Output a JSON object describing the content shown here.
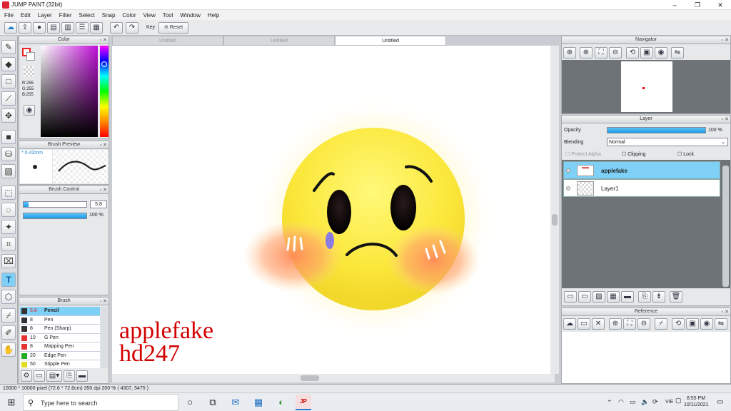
{
  "window": {
    "title": "JUMP PAINT (32bit)",
    "controls": [
      "–",
      "❐",
      "✕"
    ]
  },
  "menu": [
    "File",
    "Edit",
    "Layer",
    "Filter",
    "Select",
    "Snap",
    "Color",
    "View",
    "Tool",
    "Window",
    "Help"
  ],
  "toolbar": {
    "key_label": "Key",
    "reset_label": "Reset"
  },
  "color_panel": {
    "title": "Color",
    "r": "R:255",
    "g": "G:255",
    "b": "B:255"
  },
  "brush_preview": {
    "title": "Brush Preview",
    "size": "0.42mm"
  },
  "brush_control": {
    "title": "Brush Control",
    "size_value": "5.8",
    "opacity_value": "100 %",
    "opacity_level": 1.0
  },
  "brush_panel": {
    "title": "Brush",
    "items": [
      {
        "size": "5.8",
        "name": "Pencil",
        "color": "#333333",
        "selected": true
      },
      {
        "size": "8",
        "name": "Pen",
        "color": "#333333"
      },
      {
        "size": "8",
        "name": "Pen (Sharp)",
        "color": "#333333"
      },
      {
        "size": "10",
        "name": "G Pen",
        "color": "#e53333"
      },
      {
        "size": "8",
        "name": "Mapping Pen",
        "color": "#e53333"
      },
      {
        "size": "20",
        "name": "Edge Pen",
        "color": "#22aa22"
      },
      {
        "size": "50",
        "name": "Stipple Pen",
        "color": "#dddd22"
      }
    ]
  },
  "tabs": [
    "Untitled",
    "Untitled",
    "Untitled"
  ],
  "watermark": {
    "line1": "applefake",
    "line2": "hd247"
  },
  "status": "10000 * 10000 pixel   (72.6 * 72.6cm)   350 dpi   200 %   ( 4307, 5475 )",
  "navigator": {
    "title": "Navigator"
  },
  "layer_panel": {
    "title": "Layer",
    "opacity_label": "Opacity",
    "opacity_value": "100 %",
    "opacity_level": 1.0,
    "blending_label": "Blending",
    "blending_value": "Normal",
    "protect_alpha": "Protect Alpha",
    "clipping": "Clipping",
    "lock": "Lock",
    "layers": [
      {
        "name": "applefake",
        "selected": true
      },
      {
        "name": "Layer1",
        "selected": false
      }
    ]
  },
  "reference": {
    "title": "Reference"
  },
  "taskbar": {
    "search_placeholder": "Type here to search",
    "lang": "VIE",
    "time": "8:55 PM",
    "date": "10/11/2021"
  },
  "colors": {
    "accent": "#1b9be8",
    "selected_layer": "#7fd0f7",
    "watermark": "#d10000"
  }
}
